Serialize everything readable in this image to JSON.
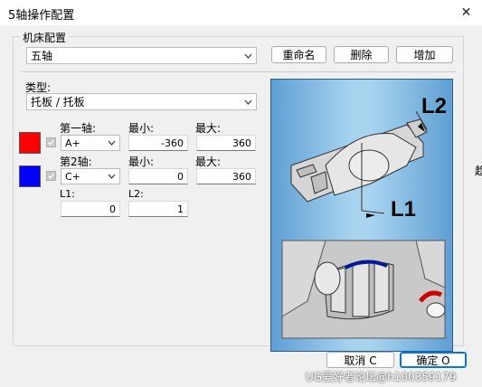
{
  "window": {
    "title": "5轴操作配置"
  },
  "machine": {
    "group_label": "机床配置",
    "selected": "五轴",
    "rename_label": "重命名",
    "delete_label": "删除",
    "add_label": "增加"
  },
  "type": {
    "label": "类型:",
    "selected": "托板 / 托板"
  },
  "axis1": {
    "color": "#ff0000",
    "label": "第一轴:",
    "value": "A+",
    "min_label": "最小:",
    "min_value": "-360",
    "max_label": "最大:",
    "max_value": "360"
  },
  "axis2": {
    "color": "#0000ff",
    "label": "第2轴:",
    "value": "C+",
    "min_label": "最小:",
    "min_value": "0",
    "max_label": "最大:",
    "max_value": "360"
  },
  "offsets": {
    "l1_label": "L1:",
    "l1_value": "0",
    "l2_label": "L2:",
    "l2_value": "1"
  },
  "preview": {
    "l1_text": "L1",
    "l2_text": "L2"
  },
  "buttons": {
    "cancel_label": "取消 C",
    "ok_label": "确定 O"
  },
  "background": {
    "fragment": "趋"
  },
  "watermark": "UG爱好者论坛@h100359179"
}
